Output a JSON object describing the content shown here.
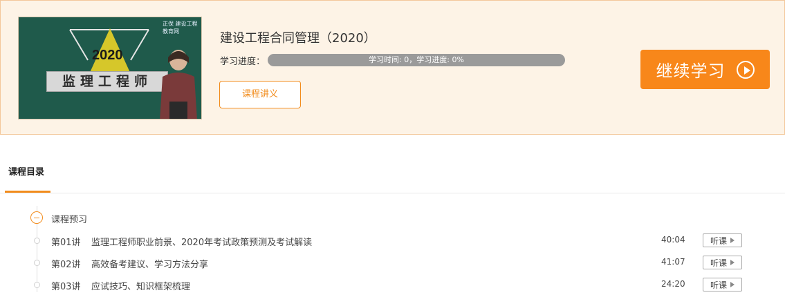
{
  "course": {
    "title": "建设工程合同管理（2020）",
    "thumbnail": {
      "year": "2020",
      "banner_text": "监理工程师",
      "logo_text": "正保 建设工程教育网"
    },
    "progress": {
      "label": "学习进度：",
      "text": "学习时间: 0，学习进度: 0%",
      "percent": 0
    },
    "notes_button": "课程讲义",
    "continue_button": "继续学习"
  },
  "catalog": {
    "tab_label": "课程目录",
    "section_title": "课程预习",
    "lessons": [
      {
        "number": "第01讲",
        "title": "监理工程师职业前景、2020年考试政策预测及考试解读",
        "duration": "40:04",
        "action": "听课"
      },
      {
        "number": "第02讲",
        "title": "高效备考建议、学习方法分享",
        "duration": "41:07",
        "action": "听课"
      },
      {
        "number": "第03讲",
        "title": "应试技巧、知识框架梳理",
        "duration": "24:20",
        "action": "听课"
      }
    ]
  },
  "colors": {
    "accent": "#f28c1c",
    "card_background": "#fdf3e6",
    "progress_track": "#9a9a9a"
  },
  "icons": {
    "play": "play-circle-icon",
    "section": "collapse-minus-icon",
    "listen": "play-triangle-icon"
  }
}
